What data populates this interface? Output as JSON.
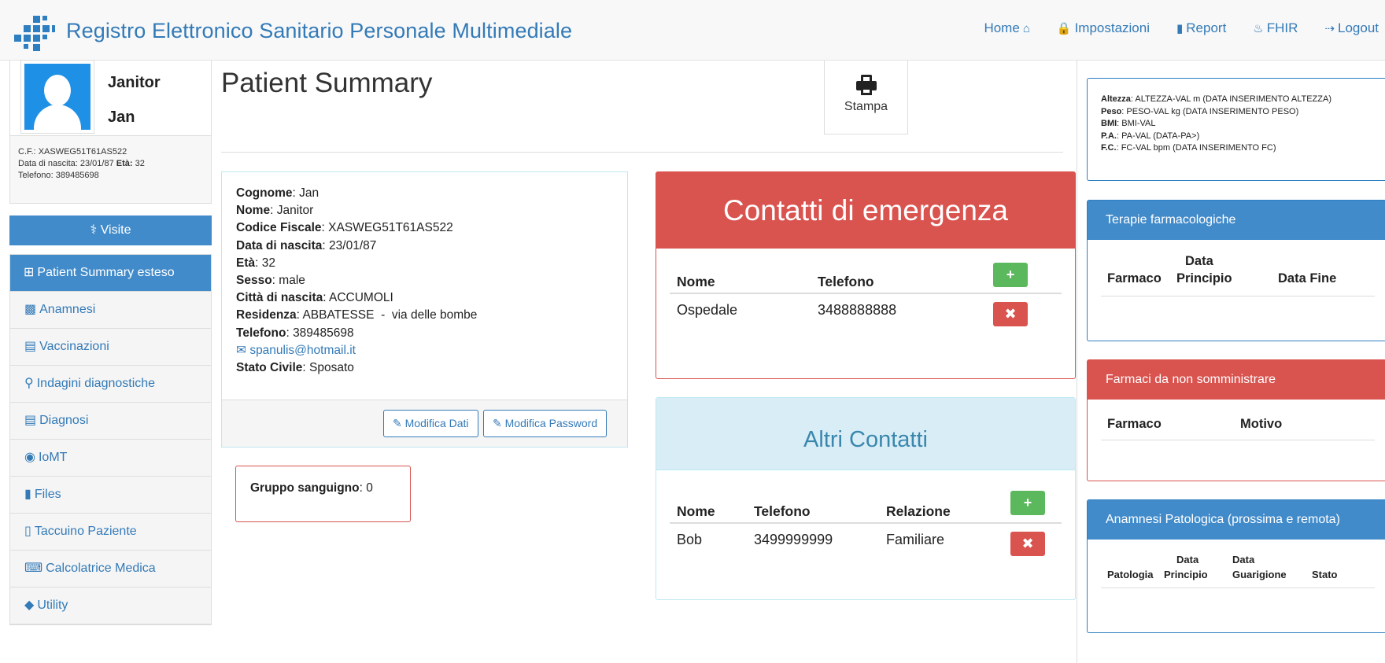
{
  "brand": {
    "title": "Registro Elettronico Sanitario Personale Multimediale",
    "color": "#337ab7"
  },
  "nav": {
    "home": "Home",
    "impostazioni": "Impostazioni",
    "report": "Report",
    "fhir": "FHIR",
    "logout": "Logout"
  },
  "patient_card": {
    "first_line": "Janitor",
    "second_line": "Jan",
    "cf_label": "C.F.:",
    "cf_value": "XASWEG51T61AS522",
    "dob_label": "Data di nascita:",
    "dob_value": "23/01/87",
    "eta_label": "Età:",
    "eta_value": "32",
    "tel_label": "Telefono:",
    "tel_value": "389485698"
  },
  "sidebar": {
    "visite": "Visite",
    "items": [
      {
        "label": "Patient Summary esteso",
        "icon": "table-icon",
        "active": true
      },
      {
        "label": "Anamnesi",
        "icon": "inbox-icon",
        "active": false
      },
      {
        "label": "Vaccinazioni",
        "icon": "document-icon",
        "active": false
      },
      {
        "label": "Indagini diagnostiche",
        "icon": "search-icon",
        "active": false
      },
      {
        "label": "Diagnosi",
        "icon": "document-icon",
        "active": false
      },
      {
        "label": "IoMT",
        "icon": "globe-icon",
        "active": false
      },
      {
        "label": "Files",
        "icon": "file-icon",
        "active": false
      },
      {
        "label": "Taccuino Paziente",
        "icon": "book-icon",
        "active": false
      },
      {
        "label": "Calcolatrice Medica",
        "icon": "keyboard-icon",
        "active": false
      },
      {
        "label": "Utility",
        "icon": "tag-icon",
        "active": false
      }
    ]
  },
  "main": {
    "title": "Patient Summary",
    "print_label": "Stampa"
  },
  "info": {
    "cognome_label": "Cognome",
    "cognome": "Jan",
    "nome_label": "Nome",
    "nome": "Janitor",
    "cf_label": "Codice Fiscale",
    "cf": "XASWEG51T61AS522",
    "dob_label": "Data di nascita",
    "dob": "23/01/87",
    "eta_label": "Età",
    "eta": "32",
    "sesso_label": "Sesso",
    "sesso": "male",
    "citta_label": "Città di nascita",
    "citta": "ACCUMOLI",
    "residenza_label": "Residenza",
    "residenza": "ABBATESSE  -  via delle bombe",
    "telefono_label": "Telefono",
    "telefono": "389485698",
    "email": "spanulis@hotmail.it",
    "stato_label": "Stato Civile",
    "stato": "Sposato",
    "btn_modifica_dati": "Modifica Dati",
    "btn_modifica_password": "Modifica Password"
  },
  "blood": {
    "label": "Gruppo sanguigno",
    "value": "0"
  },
  "emergency": {
    "title": "Contatti di emergenza",
    "col_nome": "Nome",
    "col_telefono": "Telefono",
    "rows": [
      {
        "nome": "Ospedale",
        "telefono": "3488888888"
      }
    ],
    "color": "#d9534f"
  },
  "altri": {
    "title": "Altri Contatti",
    "col_nome": "Nome",
    "col_telefono": "Telefono",
    "col_relazione": "Relazione",
    "rows": [
      {
        "nome": "Bob",
        "telefono": "3499999999",
        "relazione": "Familiare"
      }
    ]
  },
  "vitals": {
    "altezza_label": "Altezza",
    "altezza": "ALTEZZA-VAL m (DATA INSERIMENTO ALTEZZA)",
    "peso_label": "Peso",
    "peso": "PESO-VAL kg (DATA INSERIMENTO PESO)",
    "bmi_label": "BMI",
    "bmi": "BMI-VAL",
    "pa_label": "P.A.",
    "pa": "PA-VAL (DATA-PA>)",
    "fc_label": "F.C.",
    "fc": "FC-VAL bpm (DATA INSERIMENTO FC)"
  },
  "terapie": {
    "title": "Terapie farmacologiche",
    "col_farmaco": "Farmaco",
    "col_data_principio_1": "Data",
    "col_data_principio_2": "Principio",
    "col_data_fine": "Data Fine"
  },
  "non_somministrare": {
    "title": "Farmaci da non somministrare",
    "col_farmaco": "Farmaco",
    "col_motivo": "Motivo"
  },
  "anamnesi_pat": {
    "title": "Anamnesi Patologica (prossima e remota)",
    "col_patologia": "Patologia",
    "col_dp_1": "Data",
    "col_dp_2": "Principio",
    "col_dg_1": "Data",
    "col_dg_2": "Guarigione",
    "col_stato": "Stato"
  }
}
